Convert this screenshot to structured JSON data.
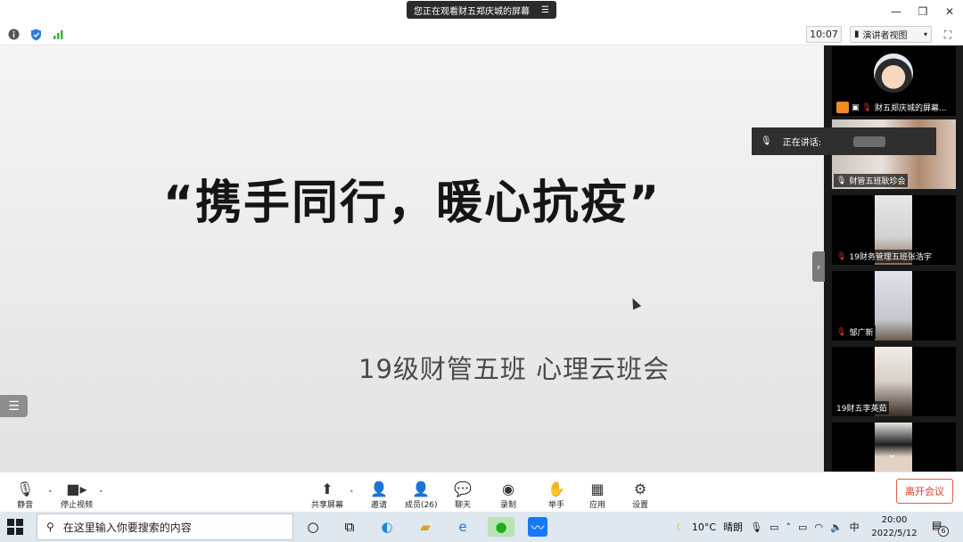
{
  "window": {
    "view_banner": "您正在观看财五郑庆城的屏幕",
    "view_banner_menu_icon": "menu-lines-icon",
    "controls": [
      "minimize-icon",
      "restore-icon",
      "close-icon"
    ]
  },
  "infobar": {
    "time": "10:07",
    "view_mode": "演讲者视图",
    "icons": [
      "info-icon",
      "shield-icon",
      "signal-icon"
    ]
  },
  "slide": {
    "title": "“携手同行，暖心抗疫”",
    "subtitle": "19级财管五班  心理云班会"
  },
  "gallery": {
    "speaking_label": "正在讲话:",
    "tiles": [
      {
        "name": "财五郑庆城的屏幕...",
        "type": "avatar"
      },
      {
        "name": "财管五班耿珍会",
        "type": "camera"
      },
      {
        "name": "19财务管理五班张浩宇",
        "type": "camera"
      },
      {
        "name": "邹广新",
        "type": "camera"
      },
      {
        "name": "19财五李英茹",
        "type": "camera"
      },
      {
        "name": "",
        "type": "camera"
      }
    ]
  },
  "toolbar": {
    "mute": "静音",
    "stop_video": "停止视频",
    "share_screen": "共享屏幕",
    "invite": "邀请",
    "participants": "成员(26)",
    "chat": "聊天",
    "record": "录制",
    "raise_hand": "举手",
    "apps": "应用",
    "settings": "设置",
    "leave": "离开会议"
  },
  "taskbar": {
    "search_placeholder": "在这里输入你要搜索的内容",
    "weather_temp": "10°C",
    "weather_text": "晴朗",
    "ime": "中",
    "time": "20:00",
    "date": "2022/5/12",
    "notification_count": "6"
  },
  "colors": {
    "leave": "#e03b2b",
    "gallery_bg": "#1a1a1a",
    "taskbar_bg": "#dfe7ef"
  }
}
